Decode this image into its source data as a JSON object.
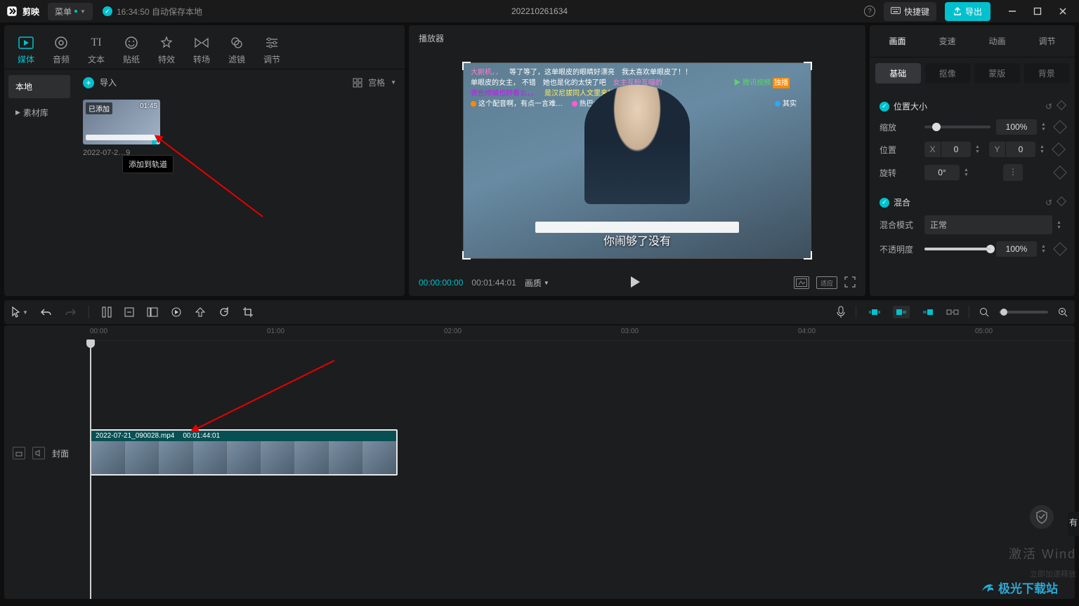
{
  "title_bar": {
    "app_name": "剪映",
    "menu_label": "菜单",
    "autosave": "16:34:50 自动保存本地",
    "project_name": "202210261634",
    "hotkey_label": "快捷键",
    "export_label": "导出"
  },
  "media_tabs": [
    {
      "id": "media",
      "label": "媒体"
    },
    {
      "id": "audio",
      "label": "音频"
    },
    {
      "id": "text",
      "label": "文本"
    },
    {
      "id": "sticker",
      "label": "贴纸"
    },
    {
      "id": "effect",
      "label": "特效"
    },
    {
      "id": "transition",
      "label": "转场"
    },
    {
      "id": "filter",
      "label": "滤镜"
    },
    {
      "id": "adjust",
      "label": "调节"
    }
  ],
  "media_side": {
    "local": "本地",
    "library": "素材库"
  },
  "media_content": {
    "import_label": "导入",
    "view_label": "宫格",
    "clip_badge": "已添加",
    "clip_duration": "01:45",
    "clip_name": "2022-07-2…9",
    "tooltip": "添加到轨道"
  },
  "player": {
    "title": "播放器",
    "subtitle_text": "你闹够了没有",
    "current_time": "00:00:00:00",
    "total_time": "00:01:44:01",
    "quality_label": "画质",
    "ratio_label": "适应"
  },
  "inspector": {
    "tabs": [
      "画面",
      "变速",
      "动画",
      "调节"
    ],
    "sub_tabs": [
      "基础",
      "抠像",
      "蒙版",
      "背景"
    ],
    "section_pos": "位置大小",
    "scale_label": "缩放",
    "scale_value": "100%",
    "position_label": "位置",
    "pos_x_label": "X",
    "pos_x_value": "0",
    "pos_y_label": "Y",
    "pos_y_value": "0",
    "rotate_label": "旋转",
    "rotate_value": "0°",
    "section_blend": "混合",
    "blend_mode_label": "混合模式",
    "blend_mode_value": "正常",
    "opacity_label": "不透明度",
    "opacity_value": "100%"
  },
  "timeline": {
    "ruler": [
      "00:00",
      "01:00",
      "02:00",
      "03:00",
      "04:00",
      "05:00"
    ],
    "cover_label": "封面",
    "clip_name": "2022-07-21_090028.mp4",
    "clip_duration": "00:01:44:01"
  },
  "overlays": {
    "activate": "激活 Wind",
    "accel": "立即加速释放",
    "side": "有",
    "jiguang": "极光下载站"
  }
}
